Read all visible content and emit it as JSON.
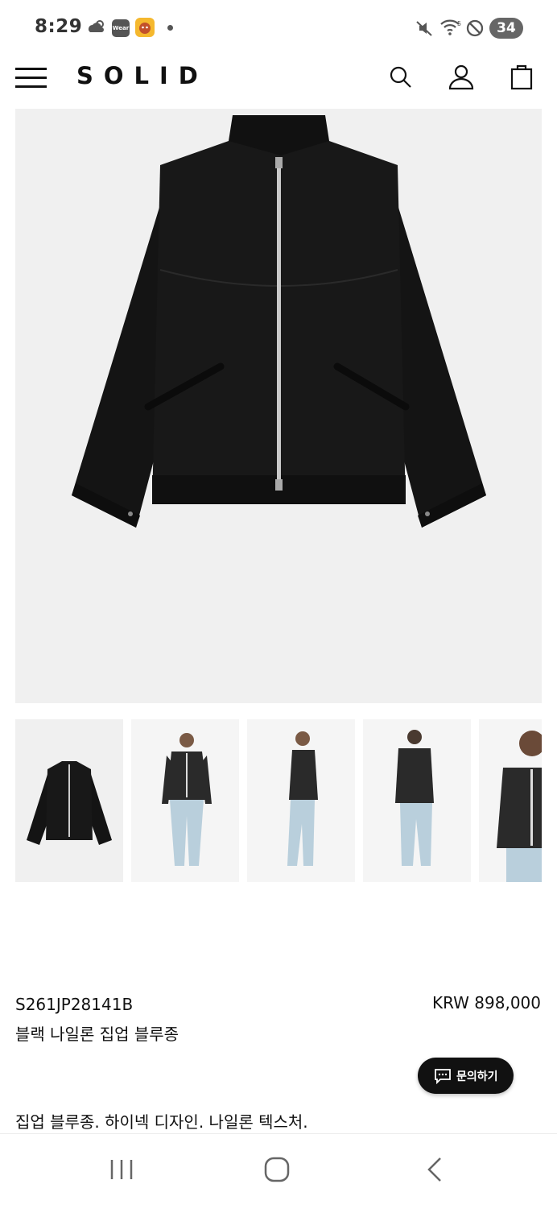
{
  "status_bar": {
    "time": "8:29",
    "weather_icon": "cloudy-sun-icon",
    "wear_badge": "Wear",
    "battery": "34"
  },
  "header": {
    "brand": "SOLID",
    "menu_icon": "hamburger-icon",
    "search_icon": "search-icon",
    "account_icon": "user-icon",
    "cart_icon": "shopping-bag-icon"
  },
  "product": {
    "code": "S261JP28141B",
    "price": "KRW 898,000",
    "name": "블랙 나일론 집업 블루종",
    "description": "집업 블루종. 하이넥 디자인. 나일론 텍스처.",
    "inquiry_label": "문의하기"
  },
  "colors": {
    "jacket": "#151515",
    "image_bg": "#f0f0f0",
    "button_bg": "#111111"
  }
}
